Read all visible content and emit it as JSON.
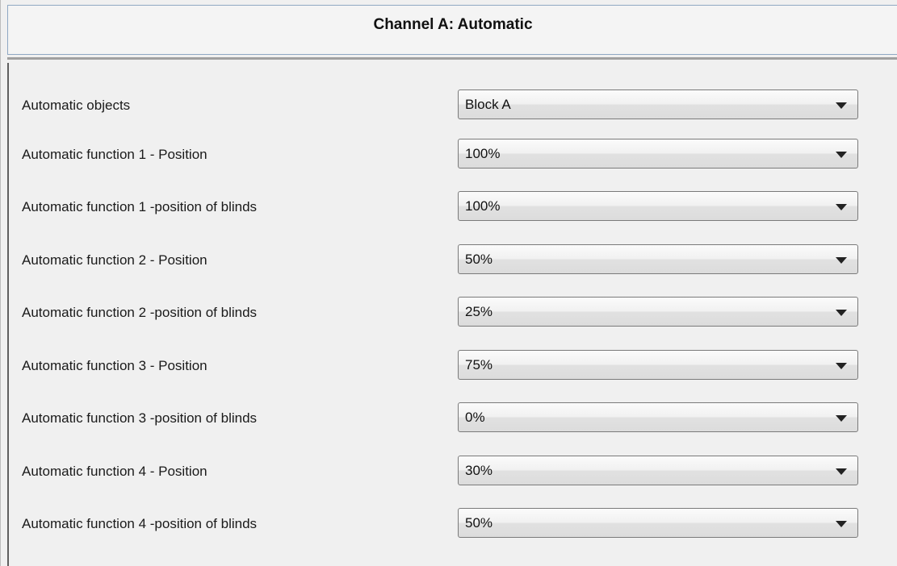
{
  "window": {
    "title": "Channel A: Automatic"
  },
  "rows": [
    {
      "label": "Automatic objects",
      "value": "Block A"
    },
    {
      "label": "Automatic function 1 - Position",
      "value": "100%"
    },
    {
      "label": "Automatic function  1 -position of blinds",
      "value": "100%"
    },
    {
      "label": "Automatic function 2 - Position",
      "value": "50%"
    },
    {
      "label": "Automatic function  2 -position of blinds",
      "value": "25%"
    },
    {
      "label": "Automatic function 3 - Position",
      "value": "75%"
    },
    {
      "label": "Automatic function  3 -position of blinds",
      "value": "0%"
    },
    {
      "label": "Automatic function 4 - Position",
      "value": "30%"
    },
    {
      "label": "Automatic function  4 -position of blinds",
      "value": "50%"
    }
  ],
  "icons": {
    "dropdown_arrow": "chevron-down-icon"
  }
}
